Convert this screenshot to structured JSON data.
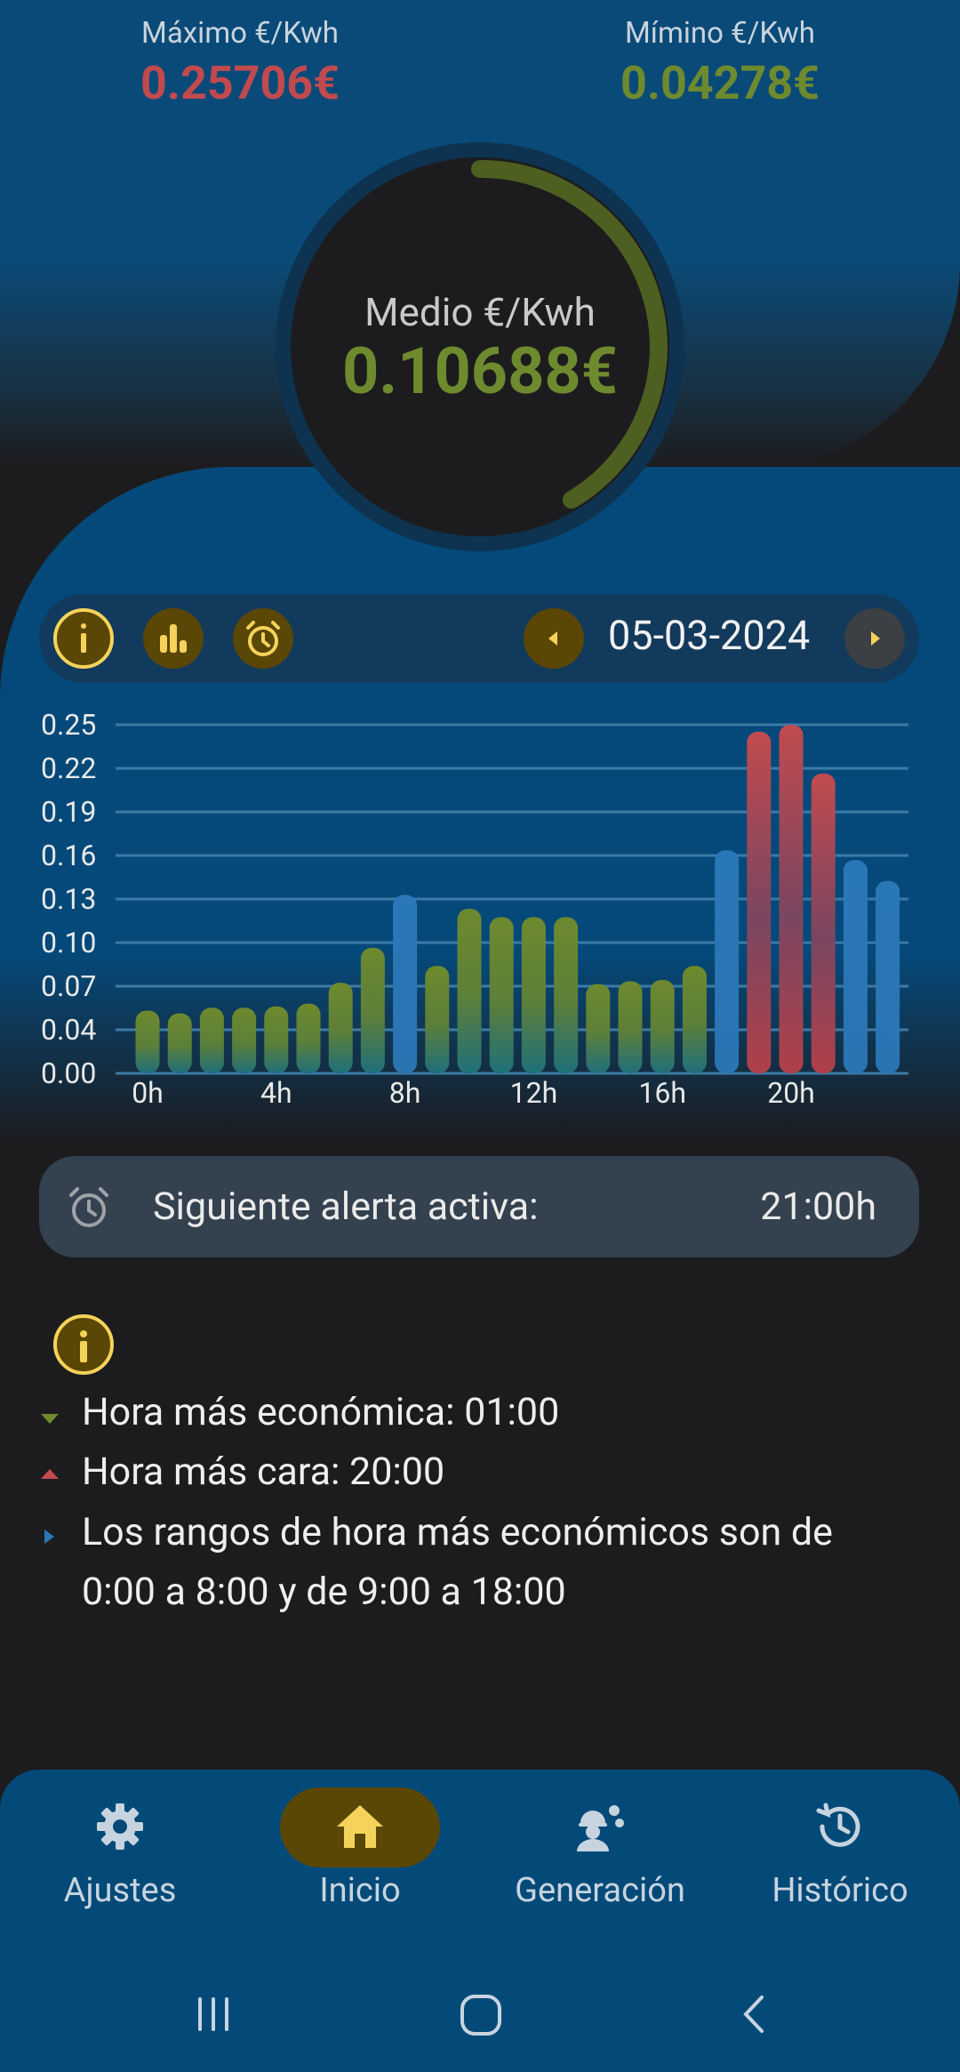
{
  "stats": {
    "max_label": "Máximo €/Kwh",
    "max_value": "0.25706€",
    "min_label": "Mímino €/Kwh",
    "min_value": "0.04278€",
    "avg_label": "Medio €/Kwh",
    "avg_value": "0.10688€"
  },
  "toolbar": {
    "date": "05-03-2024",
    "icons": [
      "info-icon",
      "bar-chart-icon",
      "alarm-icon",
      "prev-arrow-icon",
      "next-arrow-icon"
    ]
  },
  "chart_data": {
    "type": "bar",
    "categories": [
      "0h",
      "1h",
      "2h",
      "3h",
      "4h",
      "5h",
      "6h",
      "7h",
      "8h",
      "9h",
      "10h",
      "11h",
      "12h",
      "13h",
      "14h",
      "15h",
      "16h",
      "17h",
      "18h",
      "19h",
      "20h",
      "21h",
      "22h",
      "23h"
    ],
    "values": [
      0.045,
      0.043,
      0.047,
      0.047,
      0.048,
      0.05,
      0.065,
      0.09,
      0.128,
      0.077,
      0.118,
      0.112,
      0.112,
      0.112,
      0.064,
      0.066,
      0.067,
      0.077,
      0.16,
      0.245,
      0.25,
      0.215,
      0.153,
      0.138
    ],
    "colors": [
      "green",
      "green",
      "green",
      "green",
      "green",
      "green",
      "green",
      "green",
      "blue",
      "green",
      "green",
      "green",
      "green",
      "green",
      "green",
      "green",
      "green",
      "green",
      "blue",
      "red",
      "red",
      "red",
      "blue",
      "blue"
    ],
    "x_tick_labels": [
      "0h",
      "4h",
      "8h",
      "12h",
      "16h",
      "20h"
    ],
    "y_tick_labels": [
      "0.25",
      "0.22",
      "0.19",
      "0.16",
      "0.13",
      "0.10",
      "0.07",
      "0.04",
      "0.00"
    ],
    "ylim": [
      0,
      0.25
    ],
    "grid": true
  },
  "alert": {
    "label": "Siguiente alerta activa:",
    "time": "21:00h"
  },
  "info": {
    "cheapest": "Hora más económica:  01:00",
    "expensive": "Hora más cara:  20:00",
    "ranges_line1": "Los rangos de hora más económicos son de",
    "ranges_line2": "0:00 a 8:00 y de 9:00 a 18:00"
  },
  "nav": {
    "items": [
      {
        "label": "Ajustes",
        "icon": "gear-icon"
      },
      {
        "label": "Inicio",
        "icon": "home-icon"
      },
      {
        "label": "Generación",
        "icon": "worker-gear-icon"
      },
      {
        "label": "Histórico",
        "icon": "history-icon"
      }
    ],
    "active": "Inicio"
  },
  "colors": {
    "red": "#c14a4f",
    "green": "#6e8a2e",
    "blue": "#2a77b7",
    "accent_yellow": "#f5d35a"
  }
}
